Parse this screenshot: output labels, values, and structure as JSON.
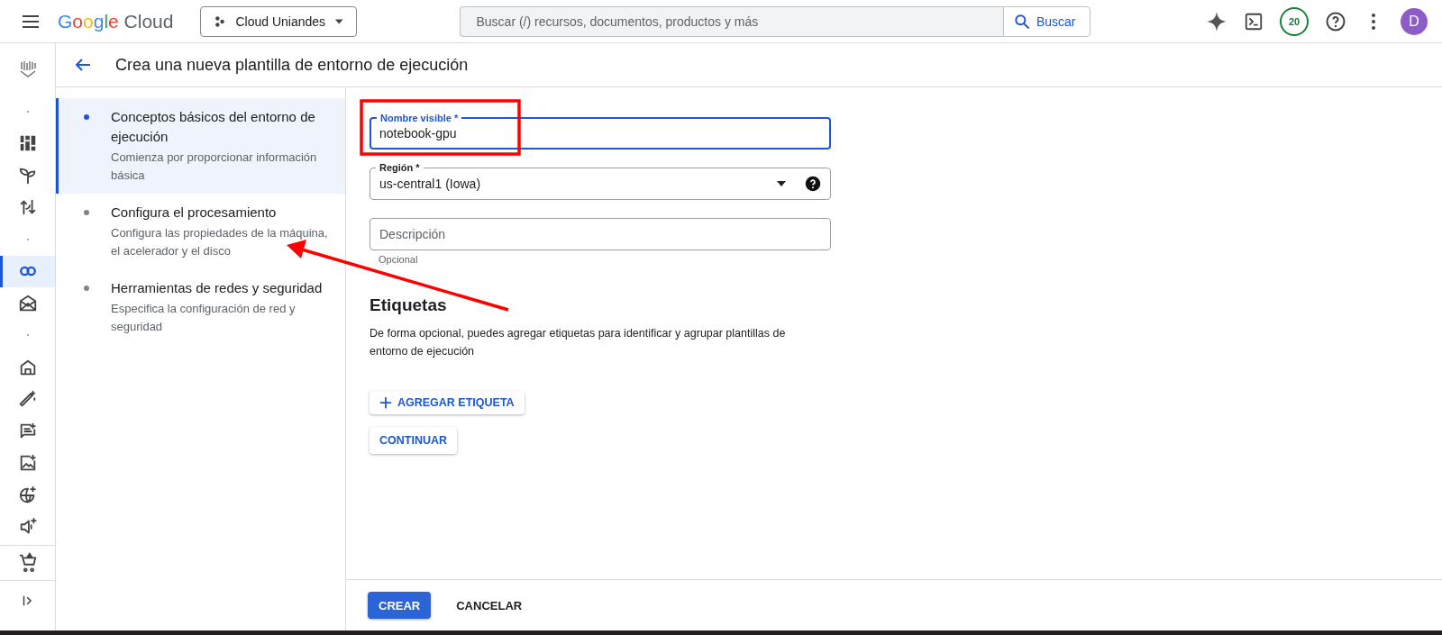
{
  "top_bar": {
    "logo": {
      "brand": "Google",
      "product": "Cloud"
    },
    "project": "Cloud Uniandes",
    "search": {
      "placeholder": "Buscar (/) recursos, documentos, productos y más",
      "button": "Buscar"
    },
    "badge": "20",
    "avatar": "D"
  },
  "rail": {
    "items": [
      {
        "kind": "dot",
        "selected": false
      },
      {
        "kind": "icon",
        "selected": false
      },
      {
        "kind": "icon",
        "selected": false
      },
      {
        "kind": "icon",
        "selected": false
      },
      {
        "kind": "dot",
        "selected": false
      },
      {
        "kind": "icon",
        "selected": true
      },
      {
        "kind": "icon",
        "selected": false
      },
      {
        "kind": "dot",
        "selected": false
      },
      {
        "kind": "icon",
        "selected": false
      },
      {
        "kind": "icon",
        "selected": false
      },
      {
        "kind": "icon",
        "selected": false
      },
      {
        "kind": "icon",
        "selected": false
      },
      {
        "kind": "icon",
        "selected": false
      },
      {
        "kind": "icon",
        "selected": false
      }
    ]
  },
  "header": {
    "title": "Crea una nueva plantilla de entorno de ejecución"
  },
  "steps": [
    {
      "title": "Conceptos básicos del entorno de ejecución",
      "description": "Comienza por proporcionar información básica",
      "selected": true
    },
    {
      "title": "Configura el procesamiento",
      "description": "Configura las propiedades de la máquina, el acelerador y el disco",
      "selected": false
    },
    {
      "title": "Herramientas de redes y seguridad",
      "description": "Especifica la configuración de red y seguridad",
      "selected": false
    }
  ],
  "form": {
    "name_field": {
      "label": "Nombre visible *",
      "value": "notebook-gpu",
      "focused": true
    },
    "region_field": {
      "label": "Región *",
      "value": "us-central1 (Iowa)"
    },
    "description_field": {
      "placeholder": "Descripción",
      "hint": "Opcional"
    },
    "labels": {
      "heading": "Etiquetas",
      "text": "De forma opcional, puedes agregar etiquetas para identificar y agrupar plantillas de entorno de ejecución",
      "add_button": "AGREGAR ETIQUETA"
    },
    "continue_button": "CONTINUAR"
  },
  "footer": {
    "create_button": "CREAR",
    "cancel_button": "CANCELAR"
  }
}
